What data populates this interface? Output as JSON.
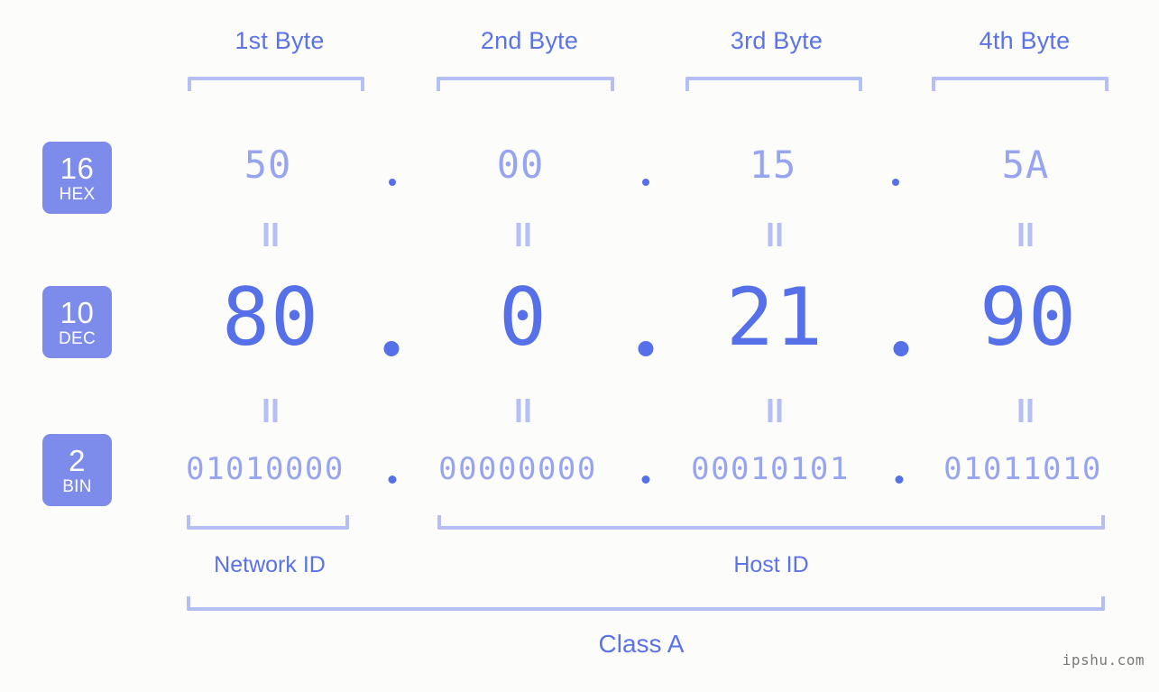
{
  "watermark": "ipshu.com",
  "theme": {
    "background": "#fcfdfa",
    "accent_strong": "#5570e8",
    "accent_label": "#5b72e8",
    "accent_light": "#97a4f0",
    "bracket": "#b6bff5",
    "badge_bg": "#7d8bea",
    "badge_text": "#ffffff"
  },
  "byte_headers": [
    {
      "label": "1st Byte"
    },
    {
      "label": "2nd Byte"
    },
    {
      "label": "3rd Byte"
    },
    {
      "label": "4th Byte"
    }
  ],
  "bases": [
    {
      "num": "16",
      "name": "HEX"
    },
    {
      "num": "10",
      "name": "DEC"
    },
    {
      "num": "2",
      "name": "BIN"
    }
  ],
  "rows": {
    "hex": {
      "base_num": "16",
      "base_name": "HEX",
      "values": [
        "50",
        "00",
        "15",
        "5A"
      ],
      "separator": "."
    },
    "dec": {
      "base_num": "10",
      "base_name": "DEC",
      "values": [
        "80",
        "0",
        "21",
        "90"
      ],
      "separator": "."
    },
    "bin": {
      "base_num": "2",
      "base_name": "BIN",
      "values": [
        "01010000",
        "00000000",
        "00010101",
        "01011010"
      ],
      "separator": "."
    }
  },
  "equals_symbol": "||",
  "sections": [
    {
      "label": "Network ID"
    },
    {
      "label": "Host ID"
    }
  ],
  "class": {
    "label": "Class A"
  },
  "chart_data": {
    "type": "table",
    "title": "IPv4 address byte breakdown",
    "ip_address": "80.0.21.90",
    "columns": [
      "1st Byte",
      "2nd Byte",
      "3rd Byte",
      "4th Byte"
    ],
    "rows": [
      {
        "base": "HEX",
        "radix": 16,
        "values": [
          "50",
          "00",
          "15",
          "5A"
        ]
      },
      {
        "base": "DEC",
        "radix": 10,
        "values": [
          "80",
          "0",
          "21",
          "90"
        ]
      },
      {
        "base": "BIN",
        "radix": 2,
        "values": [
          "01010000",
          "00000000",
          "00010101",
          "01011010"
        ]
      }
    ],
    "network_id_bytes": 1,
    "host_id_bytes": 3,
    "address_class": "Class A"
  }
}
